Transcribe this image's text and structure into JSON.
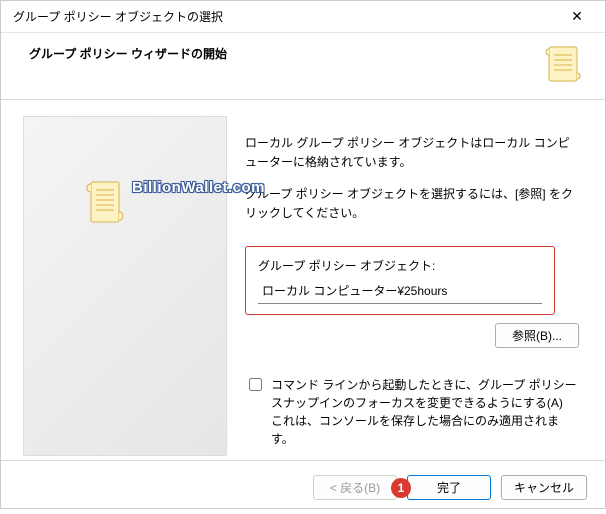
{
  "window": {
    "title": "グループ ポリシー オブジェクトの選択",
    "close_icon": "✕"
  },
  "header": {
    "title": "グループ ポリシー ウィザードの開始"
  },
  "watermark": "BillionWallet.com",
  "main": {
    "para1": "ローカル グループ ポリシー オブジェクトはローカル コンピューターに格納されています。",
    "para2": "グループ ポリシー オブジェクトを選択するには、[参照] をクリックしてください。",
    "gpo_label": "グループ ポリシー オブジェクト:",
    "gpo_value": "ローカル コンピューター¥25hours",
    "browse_label": "参照(B)...",
    "checkbox_label": "コマンド ラインから起動したときに、グループ ポリシー スナップインのフォーカスを変更できるようにする(A)",
    "checkbox_note": "これは、コンソールを保存した場合にのみ適用されます。"
  },
  "footer": {
    "back_label": "< 戻る(B)",
    "finish_label": "完了",
    "cancel_label": "キャンセル",
    "annotation": "1"
  }
}
